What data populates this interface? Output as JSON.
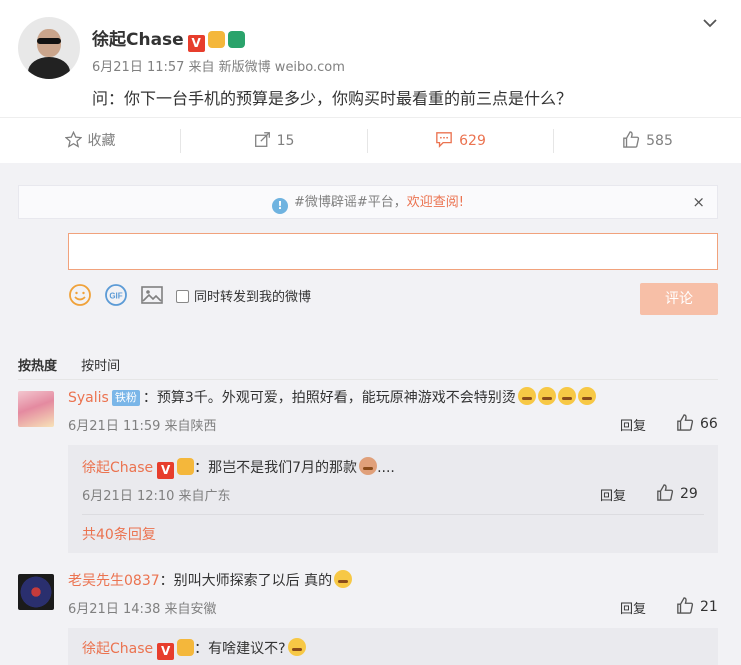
{
  "post": {
    "username": "徐起Chase",
    "v_badge": "V",
    "meta": "6月21日 11:57 来自 新版微博 weibo.com",
    "text": "问：你下一台手机的预算是多少，你购买时最看重的前三点是什么？"
  },
  "actions": {
    "favorite_label": "收藏",
    "repost_count": "15",
    "comment_count": "629",
    "like_count": "585"
  },
  "notice": {
    "prefix": "#微博辟谣#平台，",
    "link": "欢迎查阅!",
    "close": "×"
  },
  "composer": {
    "input_value": "",
    "repost_label": "同时转发到我的微博",
    "submit_label": "评论"
  },
  "sort": {
    "by_hot": "按热度",
    "by_time": "按时间"
  },
  "comments": [
    {
      "user": "Syalis",
      "badge": "铁粉",
      "text": "：预算3千。外观可爱，拍照好看，能玩原神游戏不会特别烫",
      "meta": "6月21日 11:59 来自陕西",
      "reply": "回复",
      "likes": "66",
      "sub": {
        "user": "徐起Chase",
        "v_badge": "V",
        "text": "：那岂不是我们7月的那款",
        "tail": "....",
        "meta": "6月21日 12:10 来自广东",
        "reply": "回复",
        "likes": "29",
        "more": "共40条回复"
      }
    },
    {
      "user": "老吴先生0837",
      "text": "：别叫大师探索了以后 真的",
      "meta": "6月21日 14:38 来自安徽",
      "reply": "回复",
      "likes": "21",
      "sub": {
        "user": "徐起Chase",
        "v_badge": "V",
        "text": "：有啥建议不?"
      }
    }
  ],
  "colors": {
    "accent": "#eb7350",
    "muted": "#808080",
    "panel": "#f2f2f5",
    "sub_panel": "#eaeaee"
  }
}
